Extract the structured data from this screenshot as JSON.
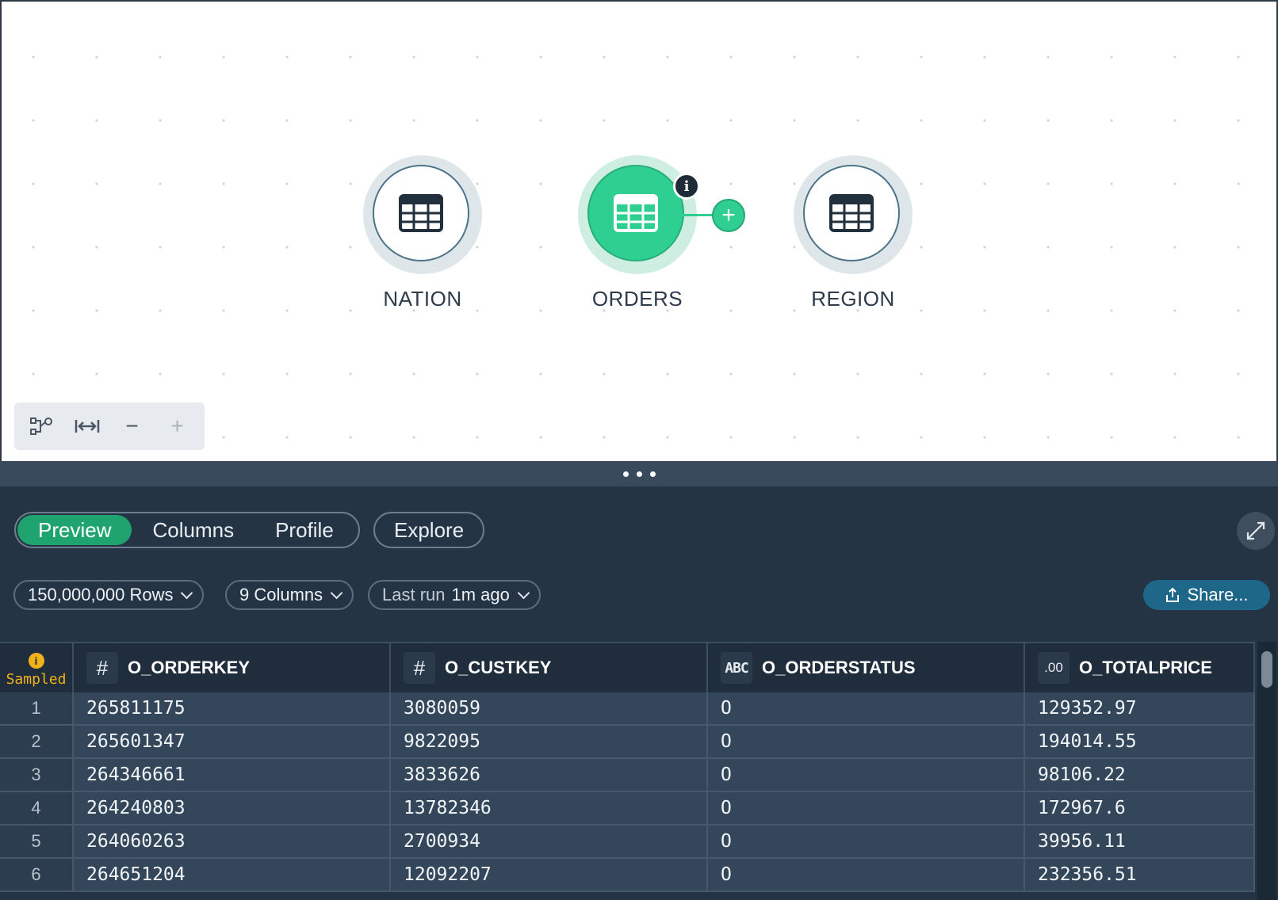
{
  "canvas": {
    "nodes": [
      {
        "label": "NATION",
        "icon": "table-icon",
        "active": false
      },
      {
        "label": "ORDERS",
        "icon": "table-icon",
        "active": true
      },
      {
        "label": "REGION",
        "icon": "table-icon",
        "active": false
      }
    ],
    "info_badge": "i",
    "add_node_symbol": "+",
    "toolbar": {
      "tools": [
        "layout-icon",
        "fit-width-icon",
        "zoom-out-icon",
        "zoom-in-icon"
      ],
      "zoom_out_symbol": "−",
      "zoom_in_symbol": "+"
    }
  },
  "panel": {
    "tabs": [
      "Preview",
      "Columns",
      "Profile"
    ],
    "active_tab": "Preview",
    "explore_label": "Explore",
    "rows_pill": "150,000,000 Rows",
    "columns_pill": "9 Columns",
    "last_run_prefix": "Last run",
    "last_run_value": "1m ago",
    "share_label": "Share..."
  },
  "table": {
    "sampled_label": "Sampled",
    "sampled_icon": "i",
    "columns": [
      {
        "type_icon": "#",
        "type": "number",
        "name": "O_ORDERKEY"
      },
      {
        "type_icon": "#",
        "type": "number",
        "name": "O_CUSTKEY"
      },
      {
        "type_icon": "ABC",
        "type": "text",
        "name": "O_ORDERSTATUS"
      },
      {
        "type_icon": ".00",
        "type": "decimal",
        "name": "O_TOTALPRICE"
      }
    ],
    "rows": [
      {
        "n": "1",
        "cells": [
          "265811175",
          "3080059",
          "O",
          "129352.97"
        ]
      },
      {
        "n": "2",
        "cells": [
          "265601347",
          "9822095",
          "O",
          "194014.55"
        ]
      },
      {
        "n": "3",
        "cells": [
          "264346661",
          "3833626",
          "O",
          "98106.22"
        ]
      },
      {
        "n": "4",
        "cells": [
          "264240803",
          "13782346",
          "O",
          "172967.6"
        ]
      },
      {
        "n": "5",
        "cells": [
          "264060263",
          "2700934",
          "O",
          "39956.11"
        ]
      },
      {
        "n": "6",
        "cells": [
          "264651204",
          "12092207",
          "O",
          "232356.51"
        ]
      }
    ]
  },
  "colors": {
    "accent_green": "#2ecf91",
    "panel_bg": "#243445",
    "share_blue": "#1f6788",
    "sampled_orange": "#f2b21b"
  }
}
